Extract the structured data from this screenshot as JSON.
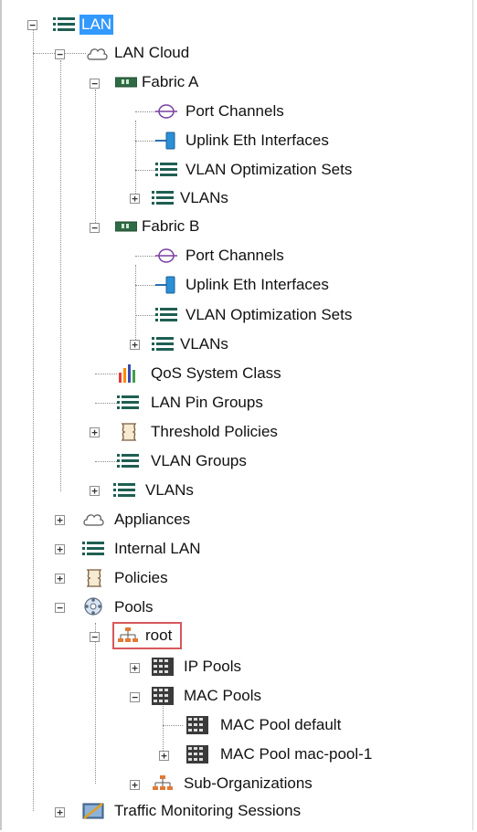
{
  "tree": {
    "root_label": "LAN",
    "lan_cloud": {
      "label": "LAN Cloud",
      "fabric_a": {
        "label": "Fabric A",
        "children": [
          "Port Channels",
          "Uplink Eth Interfaces",
          "VLAN Optimization Sets",
          "VLANs"
        ]
      },
      "fabric_b": {
        "label": "Fabric B",
        "children": [
          "Port Channels",
          "Uplink Eth Interfaces",
          "VLAN Optimization Sets",
          "VLANs"
        ]
      },
      "qos": "QoS System Class",
      "pin_groups": "LAN Pin Groups",
      "threshold": "Threshold Policies",
      "vlan_groups": "VLAN Groups",
      "vlans": "VLANs"
    },
    "appliances": "Appliances",
    "internal_lan": "Internal LAN",
    "policies": "Policies",
    "pools": {
      "label": "Pools",
      "root": {
        "label": "root",
        "ip_pools": "IP Pools",
        "mac_pools": {
          "label": "MAC Pools",
          "children": [
            "MAC Pool default",
            "MAC Pool mac-pool-1"
          ]
        },
        "sub_orgs": "Sub-Organizations"
      }
    },
    "traffic": "Traffic Monitoring Sessions"
  },
  "toggles": {
    "expanded": "−",
    "collapsed": "+"
  },
  "colors": {
    "selection": "#3399ff",
    "root_box": "#d7575b",
    "vlan_icon": "#1f5f52",
    "connector": "#8c8c8c"
  }
}
